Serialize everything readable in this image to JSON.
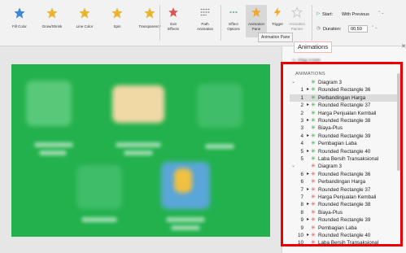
{
  "ribbon": {
    "effects": [
      {
        "label": "Fill Color",
        "icon": "star-icon",
        "color": "#3d86d6"
      },
      {
        "label": "Grow/Shrink",
        "icon": "star-icon",
        "color": "#e8b52d"
      },
      {
        "label": "Line Color",
        "icon": "star-icon",
        "color": "#e8b52d"
      },
      {
        "label": "Spin",
        "icon": "star-icon",
        "color": "#e8b52d"
      },
      {
        "label": "Transparency",
        "icon": "star-icon",
        "color": "#e8b52d"
      }
    ],
    "exit_effects": "Exit\nEffects",
    "path_animation": "Path\nAnimation",
    "effect_options": "Effect\nOptions",
    "animation_pane": "Animation\nPane",
    "trigger": "Trigger",
    "animation_painter": "Animation\nPainter",
    "start_label": "Start:",
    "start_value": "With Previous",
    "duration_label": "Duration:",
    "duration_value": "00,50",
    "tooltip": "Animation Pane"
  },
  "pane": {
    "header": "Animations",
    "play_from": "Play From",
    "list_title": "ANIMATIONS",
    "entrance_color": "#38a83b",
    "emphasis_color": "#d9534f",
    "rows": [
      {
        "num": "",
        "chev": "⌄",
        "mouse": "",
        "kind": "entrance",
        "name": "Diagram 3"
      },
      {
        "num": "1",
        "chev": "",
        "mouse": "▸",
        "kind": "entrance",
        "name": "Rounded Rectangle 36"
      },
      {
        "num": "1",
        "chev": "",
        "mouse": "",
        "kind": "entrance",
        "name": "Perbandingan Harga",
        "selected": true
      },
      {
        "num": "2",
        "chev": "",
        "mouse": "▸",
        "kind": "entrance",
        "name": "Rounded Rectangle 37"
      },
      {
        "num": "2",
        "chev": "",
        "mouse": "",
        "kind": "entrance",
        "name": "Harga Penjualan Kembali"
      },
      {
        "num": "3",
        "chev": "",
        "mouse": "▸",
        "kind": "entrance",
        "name": "Rounded Rectangle 38"
      },
      {
        "num": "3",
        "chev": "",
        "mouse": "",
        "kind": "entrance",
        "name": "Biaya-Plus"
      },
      {
        "num": "4",
        "chev": "",
        "mouse": "▸",
        "kind": "entrance",
        "name": "Rounded Rectangle 39"
      },
      {
        "num": "4",
        "chev": "",
        "mouse": "",
        "kind": "entrance",
        "name": "Pembagian Laba"
      },
      {
        "num": "5",
        "chev": "",
        "mouse": "▸",
        "kind": "entrance",
        "name": "Rounded Rectangle 40"
      },
      {
        "num": "5",
        "chev": "",
        "mouse": "",
        "kind": "entrance",
        "name": "Laba Bersih Transaksional"
      },
      {
        "num": "",
        "chev": "⌄",
        "mouse": "",
        "kind": "emphasis",
        "name": "Diagram 3"
      },
      {
        "num": "6",
        "chev": "",
        "mouse": "▸",
        "kind": "emphasis",
        "name": "Rounded Rectangle 36"
      },
      {
        "num": "6",
        "chev": "",
        "mouse": "",
        "kind": "emphasis",
        "name": "Perbandingan Harga"
      },
      {
        "num": "7",
        "chev": "",
        "mouse": "▸",
        "kind": "emphasis",
        "name": "Rounded Rectangle 37"
      },
      {
        "num": "7",
        "chev": "",
        "mouse": "",
        "kind": "emphasis",
        "name": "Harga Penjualan Kembali"
      },
      {
        "num": "8",
        "chev": "",
        "mouse": "▸",
        "kind": "emphasis",
        "name": "Rounded Rectangle 38"
      },
      {
        "num": "8",
        "chev": "",
        "mouse": "",
        "kind": "emphasis",
        "name": "Biaya-Plus"
      },
      {
        "num": "9",
        "chev": "",
        "mouse": "▸",
        "kind": "emphasis",
        "name": "Rounded Rectangle 39"
      },
      {
        "num": "9",
        "chev": "",
        "mouse": "",
        "kind": "emphasis",
        "name": "Pembagian Laba"
      },
      {
        "num": "10",
        "chev": "",
        "mouse": "▸",
        "kind": "emphasis",
        "name": "Rounded Rectangle 40"
      },
      {
        "num": "10",
        "chev": "",
        "mouse": "",
        "kind": "emphasis",
        "name": "Laba Bersih Transaksional"
      }
    ]
  },
  "colors": {
    "slide_green": "#23b14d",
    "highlight_red": "#ee0000"
  }
}
